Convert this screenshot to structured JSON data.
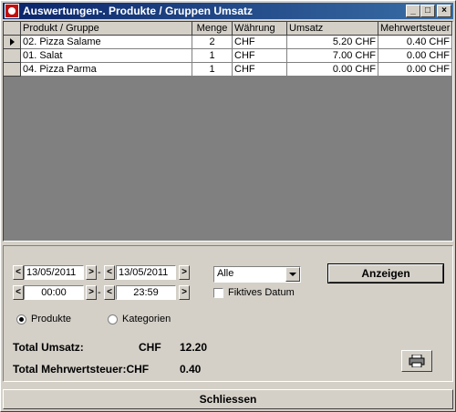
{
  "window": {
    "title": "Auswertungen-. Produkte / Gruppen Umsatz",
    "minimize": "_",
    "maximize": "□",
    "close": "×"
  },
  "grid": {
    "columns": [
      "Produkt / Gruppe",
      "Menge",
      "Währung",
      "Umsatz",
      "Mehrwertsteuer"
    ],
    "rows": [
      {
        "product": "02. Pizza Salame",
        "qty": "2",
        "currency": "CHF",
        "revenue": "5.20 CHF",
        "vat": "0.40 CHF"
      },
      {
        "product": "01. Salat",
        "qty": "1",
        "currency": "CHF",
        "revenue": "7.00 CHF",
        "vat": "0.00 CHF"
      },
      {
        "product": "04. Pizza Parma",
        "qty": "1",
        "currency": "CHF",
        "revenue": "0.00 CHF",
        "vat": "0.00 CHF"
      }
    ]
  },
  "filters": {
    "date_from": "13/05/2011",
    "date_to": "13/05/2011",
    "time_from": "00:00",
    "time_to": "23:59",
    "spin_left": "<",
    "spin_right": ">",
    "separator": "-",
    "filter_select": "Alle",
    "fictive_date_label": "Fiktives Datum",
    "show_button": "Anzeigen"
  },
  "mode": {
    "products_label": "Produkte",
    "categories_label": "Kategorien"
  },
  "totals": {
    "revenue_label": "Total Umsatz:",
    "revenue_currency": "CHF",
    "revenue_value": "12.20",
    "vat_label": "Total Mehrwertsteuer:CHF",
    "vat_value": "0.40"
  },
  "footer": {
    "close_button": "Schliessen"
  }
}
